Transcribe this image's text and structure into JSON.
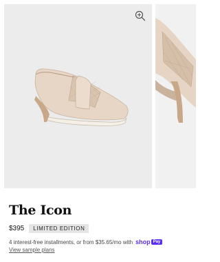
{
  "product": {
    "title": "The Icon",
    "price": "$395",
    "badge": "LIMITED EDITION",
    "installments_text": "4 interest-free installments, or from $35.65/mo with",
    "pay_brand": "shop",
    "pay_pill": "Pay",
    "view_plans_label": "View sample plans"
  },
  "gallery": {
    "zoom_icon": "zoom-in-icon",
    "main_image": "beige shoe-bootie side view",
    "next_image": "shoe close-up"
  },
  "colors": {
    "shop_pay": "#5a31f4",
    "badge_bg": "#e5e5e5",
    "image_bg": "#ececec"
  }
}
